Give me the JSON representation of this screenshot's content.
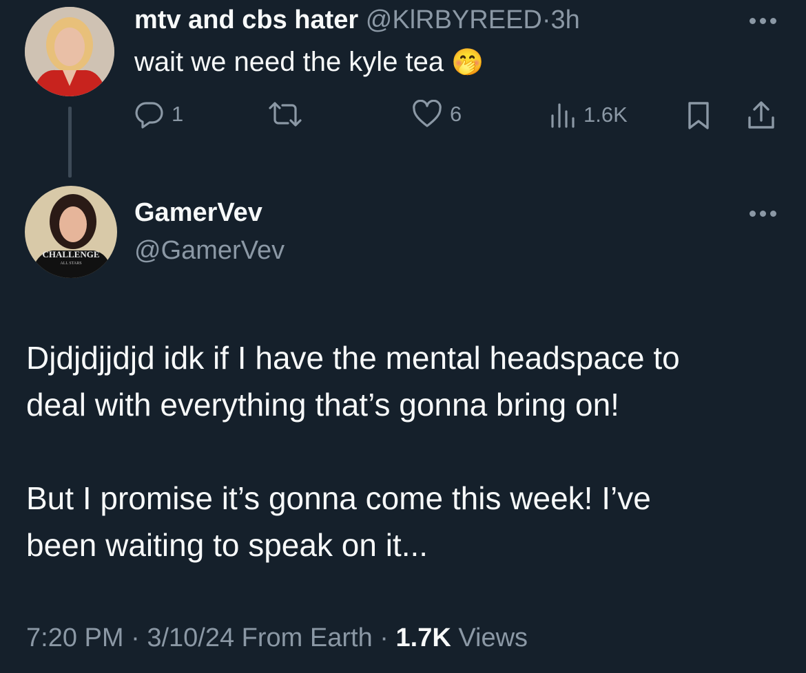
{
  "reply_tweet": {
    "display_name": "mtv and cbs hater",
    "handle": "@KlRBYREED",
    "separator": "·",
    "time_ago": "3h",
    "text": "wait we need the kyle tea",
    "emoji": "🤭",
    "actions": {
      "replies": "1",
      "retweets": "",
      "likes": "6",
      "views": "1.6K"
    }
  },
  "main_tweet": {
    "display_name": "GamerVev",
    "handle": "@GamerVev",
    "avatar_shirt_text": "CHALLENGE",
    "avatar_shirt_subtext": "ALL STARS",
    "paragraph_1_line_1": "Djdjdjjdjd idk if I have the mental headspace to",
    "paragraph_1_line_2": "deal with everything that’s gonna bring on!",
    "paragraph_2_line_1": "But I promise it’s gonna come this week! I’ve",
    "paragraph_2_line_2": "been waiting to speak on it...",
    "meta": {
      "time": "7:20 PM",
      "sep1": "·",
      "date": "3/10/24",
      "source": "From Earth",
      "sep2": "·",
      "views_count": "1.7K",
      "views_label": "Views"
    }
  },
  "icons": [
    "reply-icon",
    "retweet-icon",
    "like-icon",
    "views-icon",
    "bookmark-icon",
    "share-icon",
    "more-icon"
  ],
  "colors": {
    "background": "#15202b",
    "text": "#f7f9f9",
    "muted": "#8b98a5",
    "thread_line": "#3d4a57"
  }
}
